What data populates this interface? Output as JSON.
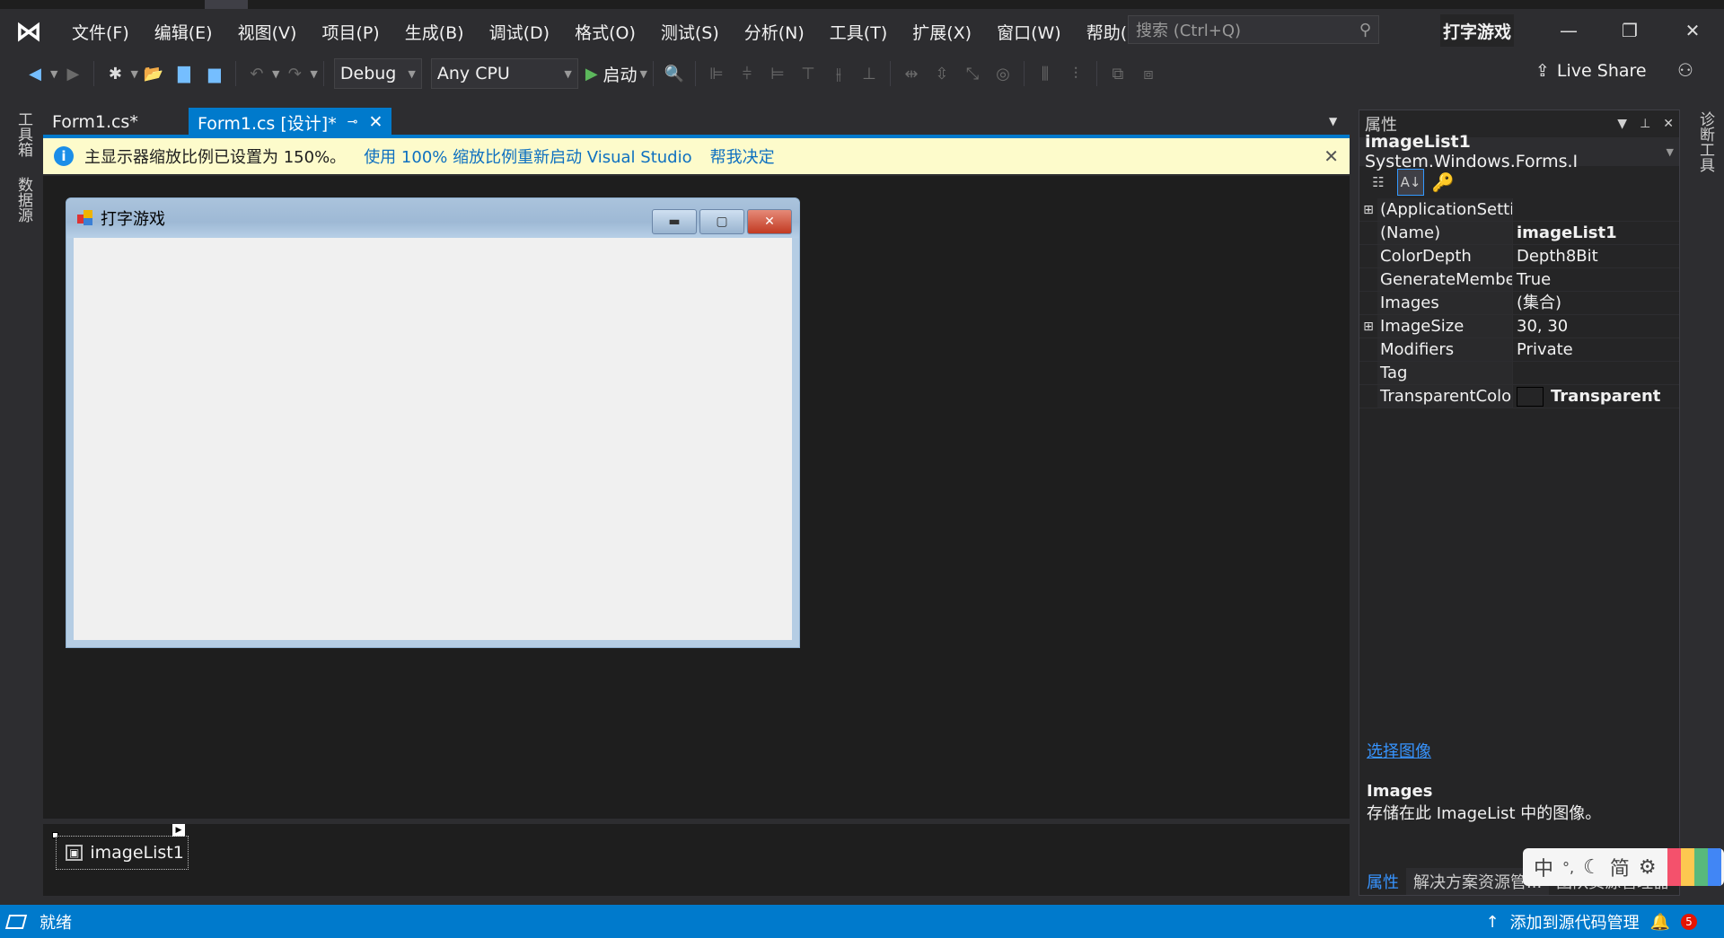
{
  "colors": {
    "accent": "#007acc",
    "infobar": "#fdfbcb",
    "background": "#2d2d30",
    "editor": "#1e1e1e"
  },
  "menu": [
    "文件(F)",
    "编辑(E)",
    "视图(V)",
    "项目(P)",
    "生成(B)",
    "调试(D)",
    "格式(O)",
    "测试(S)",
    "分析(N)",
    "工具(T)",
    "扩展(X)",
    "窗口(W)",
    "帮助(H)"
  ],
  "search": {
    "placeholder": "搜索 (Ctrl+Q)"
  },
  "app_name": "打字游戏",
  "toolbar": {
    "config": "Debug",
    "platform": "Any CPU",
    "start": "启动",
    "live_share": "Live Share"
  },
  "left_tabs": [
    "工具箱",
    "数据源"
  ],
  "right_tabs": [
    "诊断工具"
  ],
  "tabs": [
    {
      "label": "Form1.cs*"
    },
    {
      "label": "Form1.cs [设计]*",
      "active": true
    }
  ],
  "infobar": {
    "message": "主显示器缩放比例已设置为 150%。",
    "link1": "使用 100% 缩放比例重新启动 Visual Studio",
    "link2": "帮我决定"
  },
  "form": {
    "title": "打字游戏"
  },
  "tray": {
    "component": "imageList1"
  },
  "properties": {
    "title": "属性",
    "object_name": "imageList1",
    "object_type": "System.Windows.Forms.I",
    "rows": [
      {
        "name": "(ApplicationSetti",
        "value": "",
        "expand": true
      },
      {
        "name": "(Name)",
        "value": "imageList1",
        "bold": true
      },
      {
        "name": "ColorDepth",
        "value": "Depth8Bit"
      },
      {
        "name": "GenerateMembe",
        "value": "True"
      },
      {
        "name": "Images",
        "value": "(集合)"
      },
      {
        "name": "ImageSize",
        "value": "30, 30",
        "expand": true
      },
      {
        "name": "Modifiers",
        "value": "Private"
      },
      {
        "name": "Tag",
        "value": ""
      },
      {
        "name": "TransparentColo",
        "value": "Transparent",
        "bold": true,
        "swatch": true
      }
    ],
    "command_link": "选择图像",
    "desc_title": "Images",
    "desc_text": "存储在此 ImageList 中的图像。",
    "bottom_tabs": [
      "属性",
      "解决方案资源管...",
      "团队资源管理器"
    ]
  },
  "ime": {
    "lang": "中",
    "punct": "°,",
    "moon": "☾",
    "mode": "简",
    "settings": "⚙"
  },
  "status": {
    "left": "就绪",
    "source_control": "添加到源代码管理",
    "notifications": "5"
  }
}
